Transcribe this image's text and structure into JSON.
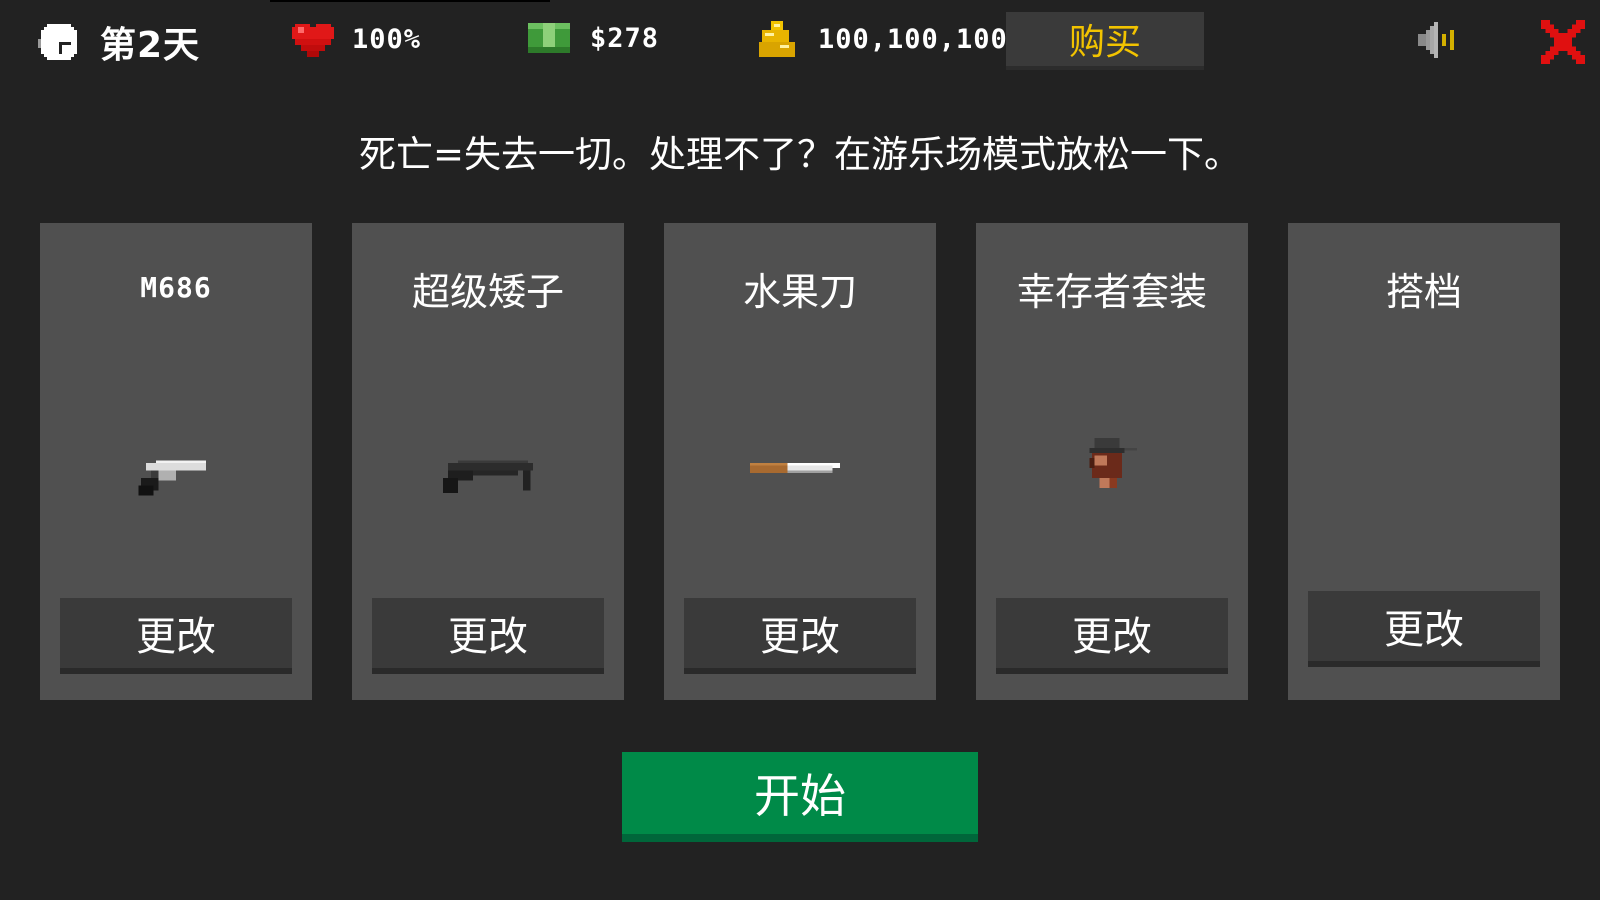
{
  "hud": {
    "day_label": "第2天",
    "health": "100%",
    "cash": "$278",
    "gold": "100,100,100",
    "buy_label": "购买",
    "icons": {
      "clock": "clock-icon",
      "health": "heart-icon",
      "cash": "cash-icon",
      "gold": "gold-coins-icon",
      "sound": "speaker-icon",
      "close": "close-icon"
    },
    "colors": {
      "buy_text": "#f2c300",
      "close": "#e01010",
      "heart": "#e01818",
      "start": "#008a48"
    }
  },
  "tip": "死亡=失去一切。处理不了？在游乐场模式放松一下。",
  "loadout": [
    {
      "title": "M686",
      "art": "revolver-icon",
      "button": "更改"
    },
    {
      "title": "超级矮子",
      "art": "shotgun-icon",
      "button": "更改"
    },
    {
      "title": "水果刀",
      "art": "knife-icon",
      "button": "更改"
    },
    {
      "title": "幸存者套装",
      "art": "survivor-head-icon",
      "button": "更改"
    },
    {
      "title": "搭档",
      "art": "",
      "button": "更改"
    }
  ],
  "start_label": "开始"
}
